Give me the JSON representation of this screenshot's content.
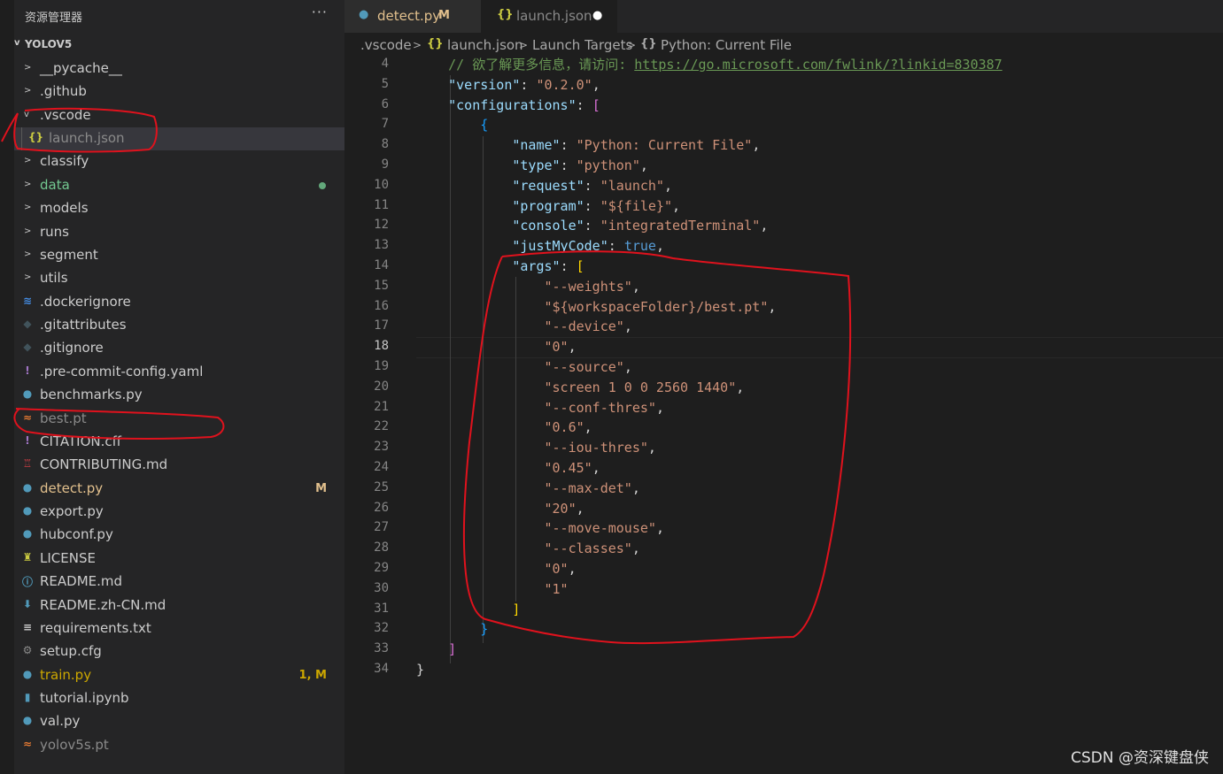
{
  "explorer": {
    "title": "资源管理器",
    "more": "···",
    "root": "YOLOV5",
    "items": [
      {
        "label": "__pycache__",
        "kind": "folder",
        "icon": ">",
        "color": "#cccccc"
      },
      {
        "label": ".github",
        "kind": "folder",
        "icon": ">",
        "color": "#cccccc"
      },
      {
        "label": ".vscode",
        "kind": "folder-open",
        "icon": "v",
        "color": "#cccccc"
      },
      {
        "label": "launch.json",
        "kind": "file",
        "icon": "{}",
        "icon_color": "#cbcb41",
        "color": "#8a8a8a"
      },
      {
        "label": "classify",
        "kind": "folder",
        "icon": ">",
        "color": "#cccccc"
      },
      {
        "label": "data",
        "kind": "folder",
        "icon": ">",
        "color": "#73c991"
      },
      {
        "label": "models",
        "kind": "folder",
        "icon": ">",
        "color": "#cccccc"
      },
      {
        "label": "runs",
        "kind": "folder",
        "icon": ">",
        "color": "#cccccc"
      },
      {
        "label": "segment",
        "kind": "folder",
        "icon": ">",
        "color": "#cccccc"
      },
      {
        "label": "utils",
        "kind": "folder",
        "icon": ">",
        "color": "#cccccc"
      },
      {
        "label": ".dockerignore",
        "kind": "file",
        "icon": "≋",
        "icon_color": "#458ee6",
        "color": "#cccccc"
      },
      {
        "label": ".gitattributes",
        "kind": "file",
        "icon": "◆",
        "icon_color": "#41535b",
        "color": "#cccccc"
      },
      {
        "label": ".gitignore",
        "kind": "file",
        "icon": "◆",
        "icon_color": "#41535b",
        "color": "#cccccc"
      },
      {
        "label": ".pre-commit-config.yaml",
        "kind": "file",
        "icon": "!",
        "icon_color": "#a074c4",
        "color": "#cccccc"
      },
      {
        "label": "benchmarks.py",
        "kind": "file",
        "icon": "●",
        "icon_color": "#519aba",
        "color": "#cccccc"
      },
      {
        "label": "best.pt",
        "kind": "file",
        "icon": "≈",
        "icon_color": "#e37933",
        "color": "#8a8a8a"
      },
      {
        "label": "CITATION.cff",
        "kind": "file",
        "icon": "!",
        "icon_color": "#a074c4",
        "color": "#cccccc"
      },
      {
        "label": "CONTRIBUTING.md",
        "kind": "file",
        "icon": "♖",
        "icon_color": "#cc3e44",
        "color": "#cccccc"
      },
      {
        "label": "detect.py",
        "kind": "file",
        "icon": "●",
        "icon_color": "#519aba",
        "color": "#e2c08d",
        "decoration": "M"
      },
      {
        "label": "export.py",
        "kind": "file",
        "icon": "●",
        "icon_color": "#519aba",
        "color": "#cccccc"
      },
      {
        "label": "hubconf.py",
        "kind": "file",
        "icon": "●",
        "icon_color": "#519aba",
        "color": "#cccccc"
      },
      {
        "label": "LICENSE",
        "kind": "file",
        "icon": "♜",
        "icon_color": "#cbcb41",
        "color": "#cccccc"
      },
      {
        "label": "README.md",
        "kind": "file",
        "icon": "ⓘ",
        "icon_color": "#519aba",
        "color": "#cccccc"
      },
      {
        "label": "README.zh-CN.md",
        "kind": "file",
        "icon": "⬇",
        "icon_color": "#519aba",
        "color": "#cccccc"
      },
      {
        "label": "requirements.txt",
        "kind": "file",
        "icon": "≡",
        "icon_color": "#cccccc",
        "color": "#cccccc"
      },
      {
        "label": "setup.cfg",
        "kind": "file",
        "icon": "⚙",
        "icon_color": "#8a8a8a",
        "color": "#cccccc"
      },
      {
        "label": "train.py",
        "kind": "file",
        "icon": "●",
        "icon_color": "#519aba",
        "color": "#cca700",
        "decoration": "1, M"
      },
      {
        "label": "tutorial.ipynb",
        "kind": "file",
        "icon": "▮",
        "icon_color": "#519aba",
        "color": "#cccccc"
      },
      {
        "label": "val.py",
        "kind": "file",
        "icon": "●",
        "icon_color": "#519aba",
        "color": "#cccccc"
      },
      {
        "label": "yolov5s.pt",
        "kind": "file",
        "icon": "≈",
        "icon_color": "#e37933",
        "color": "#8a8a8a"
      }
    ]
  },
  "tabs": [
    {
      "label": "detect.py",
      "badge": "M",
      "icon": "●",
      "icon_color": "#519aba",
      "color": "#e2c08d"
    },
    {
      "label": "launch.json",
      "badge": "●",
      "icon": "{}",
      "icon_color": "#cbcb41",
      "color": "#8a8a8a"
    }
  ],
  "breadcrumb": {
    "folder": ".vscode",
    "sep": ">",
    "file_icon": "{}",
    "file": "launch.json",
    "section": "Launch Targets",
    "item_icon": "{}",
    "item": "Python: Current File"
  },
  "editor": {
    "current_line": 18,
    "lines": [
      {
        "n": "4",
        "parts": [
          {
            "t": "    ",
            "c": ""
          },
          {
            "t": "// 欲了解更多信息，请访问: ",
            "c": "c"
          },
          {
            "t": "https://go.microsoft.com/fwlink/?linkid=830387",
            "c": "u"
          }
        ]
      },
      {
        "n": "5",
        "parts": [
          {
            "t": "    ",
            "c": ""
          },
          {
            "t": "\"version\"",
            "c": "k"
          },
          {
            "t": ": ",
            "c": ""
          },
          {
            "t": "\"0.2.0\"",
            "c": "s"
          },
          {
            "t": ",",
            "c": ""
          }
        ]
      },
      {
        "n": "6",
        "parts": [
          {
            "t": "    ",
            "c": ""
          },
          {
            "t": "\"configurations\"",
            "c": "k"
          },
          {
            "t": ": ",
            "c": ""
          },
          {
            "t": "[",
            "c": "p1"
          }
        ]
      },
      {
        "n": "7",
        "parts": [
          {
            "t": "        ",
            "c": ""
          },
          {
            "t": "{",
            "c": "p2"
          }
        ]
      },
      {
        "n": "8",
        "parts": [
          {
            "t": "            ",
            "c": ""
          },
          {
            "t": "\"name\"",
            "c": "k"
          },
          {
            "t": ": ",
            "c": ""
          },
          {
            "t": "\"Python: Current File\"",
            "c": "s"
          },
          {
            "t": ",",
            "c": ""
          }
        ]
      },
      {
        "n": "9",
        "parts": [
          {
            "t": "            ",
            "c": ""
          },
          {
            "t": "\"type\"",
            "c": "k"
          },
          {
            "t": ": ",
            "c": ""
          },
          {
            "t": "\"python\"",
            "c": "s"
          },
          {
            "t": ",",
            "c": ""
          }
        ]
      },
      {
        "n": "10",
        "parts": [
          {
            "t": "            ",
            "c": ""
          },
          {
            "t": "\"request\"",
            "c": "k"
          },
          {
            "t": ": ",
            "c": ""
          },
          {
            "t": "\"launch\"",
            "c": "s"
          },
          {
            "t": ",",
            "c": ""
          }
        ]
      },
      {
        "n": "11",
        "parts": [
          {
            "t": "            ",
            "c": ""
          },
          {
            "t": "\"program\"",
            "c": "k"
          },
          {
            "t": ": ",
            "c": ""
          },
          {
            "t": "\"${file}\"",
            "c": "s"
          },
          {
            "t": ",",
            "c": ""
          }
        ]
      },
      {
        "n": "12",
        "parts": [
          {
            "t": "            ",
            "c": ""
          },
          {
            "t": "\"console\"",
            "c": "k"
          },
          {
            "t": ": ",
            "c": ""
          },
          {
            "t": "\"integratedTerminal\"",
            "c": "s"
          },
          {
            "t": ",",
            "c": ""
          }
        ]
      },
      {
        "n": "13",
        "parts": [
          {
            "t": "            ",
            "c": ""
          },
          {
            "t": "\"justMyCode\"",
            "c": "k"
          },
          {
            "t": ": ",
            "c": ""
          },
          {
            "t": "true",
            "c": "b"
          },
          {
            "t": ",",
            "c": ""
          }
        ]
      },
      {
        "n": "14",
        "parts": [
          {
            "t": "            ",
            "c": ""
          },
          {
            "t": "\"args\"",
            "c": "k"
          },
          {
            "t": ": ",
            "c": ""
          },
          {
            "t": "[",
            "c": "p3"
          }
        ]
      },
      {
        "n": "15",
        "parts": [
          {
            "t": "                ",
            "c": ""
          },
          {
            "t": "\"--weights\"",
            "c": "s"
          },
          {
            "t": ",",
            "c": ""
          }
        ]
      },
      {
        "n": "16",
        "parts": [
          {
            "t": "                ",
            "c": ""
          },
          {
            "t": "\"${workspaceFolder}/best.pt\"",
            "c": "s"
          },
          {
            "t": ",",
            "c": ""
          }
        ]
      },
      {
        "n": "17",
        "parts": [
          {
            "t": "                ",
            "c": ""
          },
          {
            "t": "\"--device\"",
            "c": "s"
          },
          {
            "t": ",",
            "c": ""
          }
        ]
      },
      {
        "n": "18",
        "parts": [
          {
            "t": "                ",
            "c": ""
          },
          {
            "t": "\"0\"",
            "c": "s"
          },
          {
            "t": ",",
            "c": ""
          }
        ]
      },
      {
        "n": "19",
        "parts": [
          {
            "t": "                ",
            "c": ""
          },
          {
            "t": "\"--source\"",
            "c": "s"
          },
          {
            "t": ",",
            "c": ""
          }
        ]
      },
      {
        "n": "20",
        "parts": [
          {
            "t": "                ",
            "c": ""
          },
          {
            "t": "\"screen 1 0 0 2560 1440\"",
            "c": "s"
          },
          {
            "t": ",",
            "c": ""
          }
        ]
      },
      {
        "n": "21",
        "parts": [
          {
            "t": "                ",
            "c": ""
          },
          {
            "t": "\"--conf-thres\"",
            "c": "s"
          },
          {
            "t": ",",
            "c": ""
          }
        ]
      },
      {
        "n": "22",
        "parts": [
          {
            "t": "                ",
            "c": ""
          },
          {
            "t": "\"0.6\"",
            "c": "s"
          },
          {
            "t": ",",
            "c": ""
          }
        ]
      },
      {
        "n": "23",
        "parts": [
          {
            "t": "                ",
            "c": ""
          },
          {
            "t": "\"--iou-thres\"",
            "c": "s"
          },
          {
            "t": ",",
            "c": ""
          }
        ]
      },
      {
        "n": "24",
        "parts": [
          {
            "t": "                ",
            "c": ""
          },
          {
            "t": "\"0.45\"",
            "c": "s"
          },
          {
            "t": ",",
            "c": ""
          }
        ]
      },
      {
        "n": "25",
        "parts": [
          {
            "t": "                ",
            "c": ""
          },
          {
            "t": "\"--max-det\"",
            "c": "s"
          },
          {
            "t": ",",
            "c": ""
          }
        ]
      },
      {
        "n": "26",
        "parts": [
          {
            "t": "                ",
            "c": ""
          },
          {
            "t": "\"20\"",
            "c": "s"
          },
          {
            "t": ",",
            "c": ""
          }
        ]
      },
      {
        "n": "27",
        "parts": [
          {
            "t": "                ",
            "c": ""
          },
          {
            "t": "\"--move-mouse\"",
            "c": "s"
          },
          {
            "t": ",",
            "c": ""
          }
        ]
      },
      {
        "n": "28",
        "parts": [
          {
            "t": "                ",
            "c": ""
          },
          {
            "t": "\"--classes\"",
            "c": "s"
          },
          {
            "t": ",",
            "c": ""
          }
        ]
      },
      {
        "n": "29",
        "parts": [
          {
            "t": "                ",
            "c": ""
          },
          {
            "t": "\"0\"",
            "c": "s"
          },
          {
            "t": ",",
            "c": ""
          }
        ]
      },
      {
        "n": "30",
        "parts": [
          {
            "t": "                ",
            "c": ""
          },
          {
            "t": "\"1\"",
            "c": "s"
          }
        ]
      },
      {
        "n": "31",
        "parts": [
          {
            "t": "            ",
            "c": ""
          },
          {
            "t": "]",
            "c": "p3"
          }
        ]
      },
      {
        "n": "32",
        "parts": [
          {
            "t": "        ",
            "c": ""
          },
          {
            "t": "}",
            "c": "p2"
          }
        ]
      },
      {
        "n": "33",
        "parts": [
          {
            "t": "    ",
            "c": ""
          },
          {
            "t": "]",
            "c": "p1"
          }
        ]
      },
      {
        "n": "34",
        "parts": [
          {
            "t": "}",
            "c": ""
          }
        ]
      }
    ]
  },
  "watermark": "CSDN @资深键盘侠",
  "colors": {
    "annotation": "#e0121d",
    "modified": "#e2c08d",
    "selection": "#37373d"
  }
}
